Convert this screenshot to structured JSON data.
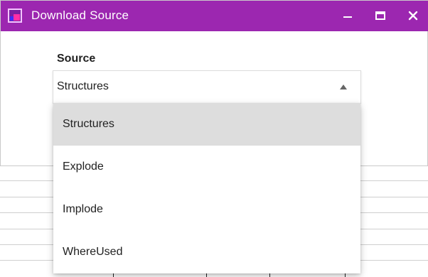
{
  "window": {
    "title": "Download Source",
    "icon": "app-icon",
    "titlebar_color": "#9c27b0",
    "controls": {
      "minimize": "minimize-icon",
      "maximize": "maximize-icon",
      "close": "close-icon"
    }
  },
  "form": {
    "source_label": "Source",
    "source_value": "Structures"
  },
  "dropdown": {
    "options": [
      {
        "label": "Structures",
        "selected": true
      },
      {
        "label": "Explode",
        "selected": false
      },
      {
        "label": "Implode",
        "selected": false
      },
      {
        "label": "WhereUsed",
        "selected": false
      }
    ]
  }
}
